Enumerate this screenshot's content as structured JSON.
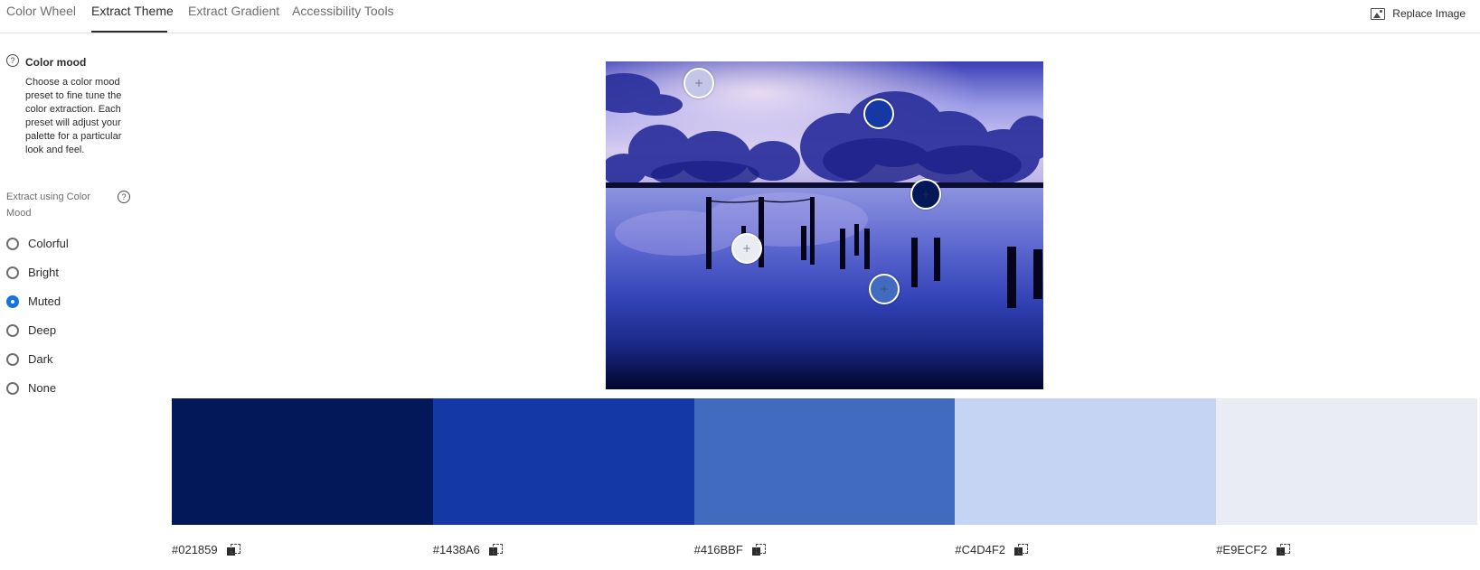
{
  "tabs": [
    {
      "label": "Color Wheel"
    },
    {
      "label": "Extract Theme"
    },
    {
      "label": "Extract Gradient"
    },
    {
      "label": "Accessibility Tools"
    }
  ],
  "active_tab": "Extract Theme",
  "replace_image_label": "Replace Image",
  "sidebar": {
    "help_glyph": "?",
    "mood_title": "Color mood",
    "mood_description": "Choose a color mood preset to fine tune the color extraction. Each preset will adjust your palette for a particular look and feel.",
    "extract_label": "Extract using Color Mood",
    "options": [
      {
        "label": "Colorful",
        "checked": false
      },
      {
        "label": "Bright",
        "checked": false
      },
      {
        "label": "Muted",
        "checked": true
      },
      {
        "label": "Deep",
        "checked": false
      },
      {
        "label": "Dark",
        "checked": false
      },
      {
        "label": "None",
        "checked": false
      }
    ]
  },
  "picker_glyph": "+",
  "palette": [
    {
      "hex": "#021859",
      "color": "#021859"
    },
    {
      "hex": "#1438A6",
      "color": "#1438A6"
    },
    {
      "hex": "#416BBF",
      "color": "#416BBF"
    },
    {
      "hex": "#C4D4F2",
      "color": "#C4D4F2"
    },
    {
      "hex": "#E9ECF2",
      "color": "#E9ECF2"
    }
  ]
}
